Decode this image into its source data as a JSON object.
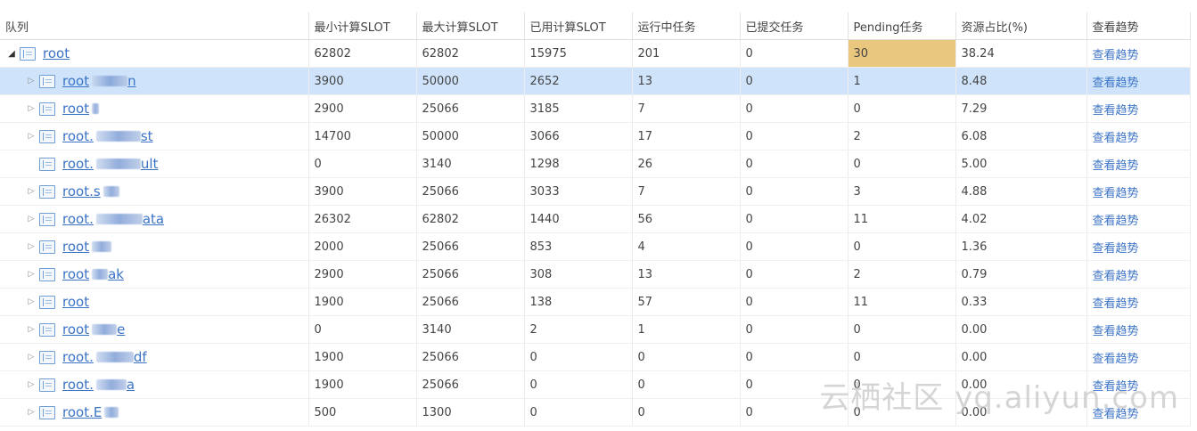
{
  "columns": [
    "队列",
    "最小计算SLOT",
    "最大计算SLOT",
    "已用计算SLOT",
    "运行中任务",
    "已提交任务",
    "Pending任务",
    "资源占比(%)",
    "查看趋势"
  ],
  "rows": [
    {
      "queue": "root",
      "suffix": "",
      "min": "62802",
      "max": "62802",
      "used": "15975",
      "running": "201",
      "submitted": "0",
      "pending": "30",
      "ratio": "38.24",
      "trend": "查看趋势",
      "level": 0,
      "arrow": "open"
    },
    {
      "queue": "root",
      "suffix": "n",
      "min": "3900",
      "max": "50000",
      "used": "2652",
      "running": "13",
      "submitted": "0",
      "pending": "1",
      "ratio": "8.48",
      "trend": "查看趋势",
      "level": 1,
      "arrow": "closed"
    },
    {
      "queue": "root",
      "suffix": "",
      "min": "2900",
      "max": "25066",
      "used": "3185",
      "running": "7",
      "submitted": "0",
      "pending": "0",
      "ratio": "7.29",
      "trend": "查看趋势",
      "level": 1,
      "arrow": "closed"
    },
    {
      "queue": "root.",
      "suffix": "st",
      "min": "14700",
      "max": "50000",
      "used": "3066",
      "running": "17",
      "submitted": "0",
      "pending": "2",
      "ratio": "6.08",
      "trend": "查看趋势",
      "level": 1,
      "arrow": "closed"
    },
    {
      "queue": "root.",
      "suffix": "ult",
      "min": "0",
      "max": "3140",
      "used": "1298",
      "running": "26",
      "submitted": "0",
      "pending": "0",
      "ratio": "5.00",
      "trend": "查看趋势",
      "level": 1,
      "arrow": "none"
    },
    {
      "queue": "root.s",
      "suffix": "",
      "min": "3900",
      "max": "25066",
      "used": "3033",
      "running": "7",
      "submitted": "0",
      "pending": "3",
      "ratio": "4.88",
      "trend": "查看趋势",
      "level": 1,
      "arrow": "closed"
    },
    {
      "queue": "root.",
      "suffix": "ata",
      "min": "26302",
      "max": "62802",
      "used": "1440",
      "running": "56",
      "submitted": "0",
      "pending": "11",
      "ratio": "4.02",
      "trend": "查看趋势",
      "level": 1,
      "arrow": "closed"
    },
    {
      "queue": "root",
      "suffix": "",
      "min": "2000",
      "max": "25066",
      "used": "853",
      "running": "4",
      "submitted": "0",
      "pending": "0",
      "ratio": "1.36",
      "trend": "查看趋势",
      "level": 1,
      "arrow": "closed"
    },
    {
      "queue": "root",
      "suffix": "ak",
      "min": "2900",
      "max": "25066",
      "used": "308",
      "running": "13",
      "submitted": "0",
      "pending": "2",
      "ratio": "0.79",
      "trend": "查看趋势",
      "level": 1,
      "arrow": "closed"
    },
    {
      "queue": "root",
      "suffix": "",
      "min": "1900",
      "max": "25066",
      "used": "138",
      "running": "57",
      "submitted": "0",
      "pending": "11",
      "ratio": "0.33",
      "trend": "查看趋势",
      "level": 1,
      "arrow": "closed"
    },
    {
      "queue": "root",
      "suffix": "e",
      "min": "0",
      "max": "3140",
      "used": "2",
      "running": "1",
      "submitted": "0",
      "pending": "0",
      "ratio": "0.00",
      "trend": "查看趋势",
      "level": 1,
      "arrow": "closed"
    },
    {
      "queue": "root.",
      "suffix": "df",
      "min": "1900",
      "max": "25066",
      "used": "0",
      "running": "0",
      "submitted": "0",
      "pending": "0",
      "ratio": "0.00",
      "trend": "查看趋势",
      "level": 1,
      "arrow": "closed"
    },
    {
      "queue": "root.",
      "suffix": "a",
      "min": "1900",
      "max": "25066",
      "used": "0",
      "running": "0",
      "submitted": "0",
      "pending": "0",
      "ratio": "0.00",
      "trend": "查看趋势",
      "level": 1,
      "arrow": "closed"
    },
    {
      "queue": "root.E",
      "suffix": "",
      "min": "500",
      "max": "1300",
      "used": "0",
      "running": "0",
      "submitted": "0",
      "pending": "0",
      "ratio": "0.00",
      "trend": "查看趋势",
      "level": 1,
      "arrow": "closed"
    }
  ],
  "selected_row": 1,
  "highlight": {
    "row": 0,
    "column": "pending",
    "color": "#e9c77e"
  },
  "colors": {
    "link": "#3b73c7",
    "selected": "#cfe4fb"
  },
  "watermark": "云栖社区 yq.aliyun.com"
}
